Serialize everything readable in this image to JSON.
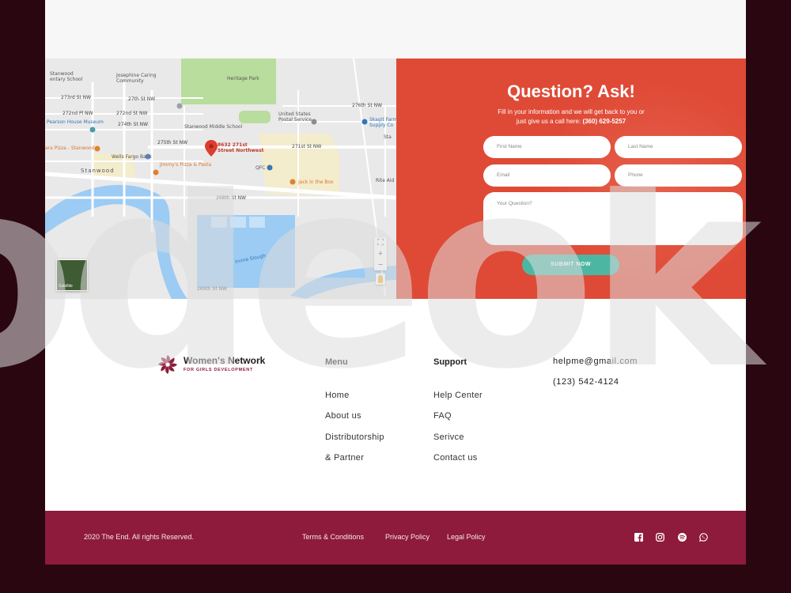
{
  "map": {
    "labels": {
      "stanwood_school": "Stanwood\nentary School",
      "josephine": "Josephine Caring\nCommunity",
      "heritage_park": "Heritage Park",
      "pearson": "Pearson House Museum",
      "pizza": "ara Pizza - Stanwood",
      "middle_school": "Stanwood Middle School",
      "post_service": "United States\nPostal Service",
      "skagit": "Skagit Farm\nSupply Co",
      "address": "8632 271st\nStreet Northwest",
      "wells": "Wells Fargo Bank",
      "jimmys": "Jimmy's Pizza & Pasta",
      "qfc": "QFC",
      "jack": "Jack in the Box",
      "rite_aid": "Rite Aid",
      "stanwood": "Stanwood",
      "st_268": "268th St NW",
      "st_271": "271st St NW",
      "st_272": "272nd Pl NW",
      "st_272b": "272nd St NW",
      "st_273": "273rd St NW",
      "st_274": "274th St NW",
      "st_275": "275th St NW",
      "st_276": "276th St NW",
      "st_27th": "27th St NW",
      "st_269": "269th St NW",
      "slough": "Irvine Slough",
      "satellite": "Satellite",
      "sta": "Sta"
    },
    "zoom_plus": "+",
    "zoom_minus": "−",
    "fullscreen": "⛶",
    "colors": {
      "water": "#9ccbf4",
      "park": "#b7dc9a",
      "land": "#e8e8e8",
      "pin": "#db3d2e"
    }
  },
  "form": {
    "title": "Question? Ask!",
    "subtitle_line1": "Fill in your information and we will get back to you or",
    "subtitle_line2_prefix": "just give us  a call here:",
    "subtitle_phone": "(360) 629-5257",
    "first_name_placeholder": "First Name",
    "last_name_placeholder": "Last Name",
    "email_placeholder": "Email",
    "phone_placeholder": "Phone",
    "question_placeholder": "Your Question?",
    "submit_label": "SUBMIT NOW",
    "colors": {
      "panel": "#df4a36",
      "button": "#4db6a3"
    }
  },
  "watermark": "odeok",
  "footer": {
    "brand_name": "Women's Network",
    "brand_tagline": "FOR GIRLS DEVELOPMENT",
    "menu": {
      "title": "Menu",
      "items": [
        "Home",
        "About us",
        "Distributorship",
        "& Partner"
      ]
    },
    "support": {
      "title": "Support",
      "items": [
        "Help Center",
        "FAQ",
        "Serivce",
        "Contact us"
      ]
    },
    "contact": {
      "email": "helpme@gmail.com",
      "phone": "(123) 542-4124"
    }
  },
  "bottom_bar": {
    "copyright": "2020 The End. All rights Reserved.",
    "links": [
      "Terms & Conditions",
      "Privacy Policy",
      "Legal Policy"
    ],
    "social_icons": [
      "facebook-icon",
      "instagram-icon",
      "spotify-icon",
      "whatsapp-icon"
    ],
    "colors": {
      "background": "#8e1a3c"
    }
  }
}
